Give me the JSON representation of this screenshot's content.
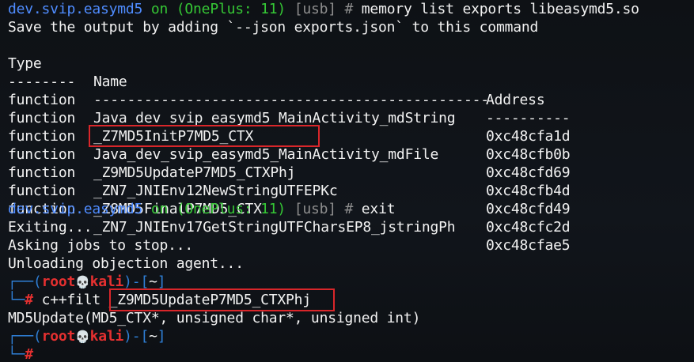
{
  "prompt1": {
    "context": "dev.svip.easymd5",
    "on": "on",
    "device": "(OnePlus: 11)",
    "transport": "[usb]",
    "hash": "#",
    "command": "memory list exports libeasymd5.so"
  },
  "save_hint": "Save the output by adding `--json exports.json` to this command",
  "table": {
    "headers": {
      "type": "Type",
      "name": "Name",
      "address": "Address"
    },
    "separators": {
      "type": "--------",
      "name": "-----------------------------------------------",
      "address": "----------"
    },
    "rows": [
      {
        "type": "function",
        "name": "Java_dev_svip_easymd5_MainActivity_mdString",
        "address": "0xc48cfa1d"
      },
      {
        "type": "function",
        "name": "_Z7MD5InitP7MD5_CTX",
        "address": "0xc48cfb0b"
      },
      {
        "type": "function",
        "name": "Java_dev_svip_easymd5_MainActivity_mdFile",
        "address": "0xc48cfd69"
      },
      {
        "type": "function",
        "name": "_Z9MD5UpdateP7MD5_CTXPhj",
        "address": "0xc48cfb4d"
      },
      {
        "type": "function",
        "name": "_ZN7_JNIEnv12NewStringUTFEPKc",
        "address": "0xc48cfd49"
      },
      {
        "type": "function",
        "name": "_Z8MD5FinalP7MD5_CTX",
        "address": "0xc48cfc2d"
      },
      {
        "type": "function",
        "name": "_ZN7_JNIEnv17GetStringUTFCharsEP8_jstringPh",
        "address": "0xc48cfae5"
      }
    ]
  },
  "prompt2": {
    "context": "dev.svip.easymd5",
    "on": "on",
    "device": "(OnePlus: 11)",
    "transport": "[usb]",
    "hash": "#",
    "command": "exit"
  },
  "exit_lines": [
    "Exiting...",
    "Asking jobs to stop...",
    "Unloading objection agent..."
  ],
  "shell1": {
    "open": "┌──(",
    "user": "root",
    "skull": "💀",
    "host": "kali",
    "close": ")-[",
    "dir": "~",
    "end": "]",
    "prompt_corner": "└─",
    "hash": "#",
    "command": "c++filt",
    "argument": "_Z9MD5UpdateP7MD5_CTXPhj"
  },
  "demangled": "MD5Update(MD5_CTX*, unsigned char*, unsigned int)",
  "shell2": {
    "open": "┌──(",
    "user": "root",
    "skull": "💀",
    "host": "kali",
    "close": ")-[",
    "dir": "~",
    "end": "]",
    "prompt_corner": "└─",
    "hash": "#"
  },
  "colors": {
    "context": "#4f8cff",
    "device": "#35c735",
    "muted": "#8e8e8e",
    "root": "#e53030",
    "highlight_box": "#d9262a",
    "background": "#0f1216"
  }
}
